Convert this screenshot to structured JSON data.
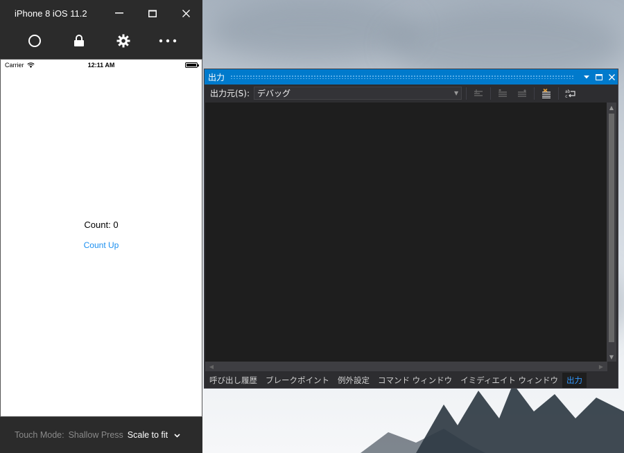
{
  "simulator": {
    "title": "iPhone 8 iOS 11.2",
    "status": {
      "carrier": "Carrier",
      "time": "12:11 AM"
    },
    "app": {
      "count_label": "Count:",
      "count_value": "0",
      "button_label": "Count Up"
    },
    "footer": {
      "touch_mode_label": "Touch Mode:",
      "shallow_press": "Shallow Press",
      "scale_option": "Scale to fit"
    }
  },
  "output_window": {
    "title": "出力",
    "source_label": "出力元(S):",
    "source_value": "デバッグ",
    "tabs": [
      "呼び出し履歴",
      "ブレークポイント",
      "例外設定",
      "コマンド ウィンドウ",
      "イミディエイト ウィンドウ",
      "出力"
    ],
    "active_tab": "出力"
  },
  "colors": {
    "accent": "#007acc",
    "link": "#1a8ff0"
  }
}
